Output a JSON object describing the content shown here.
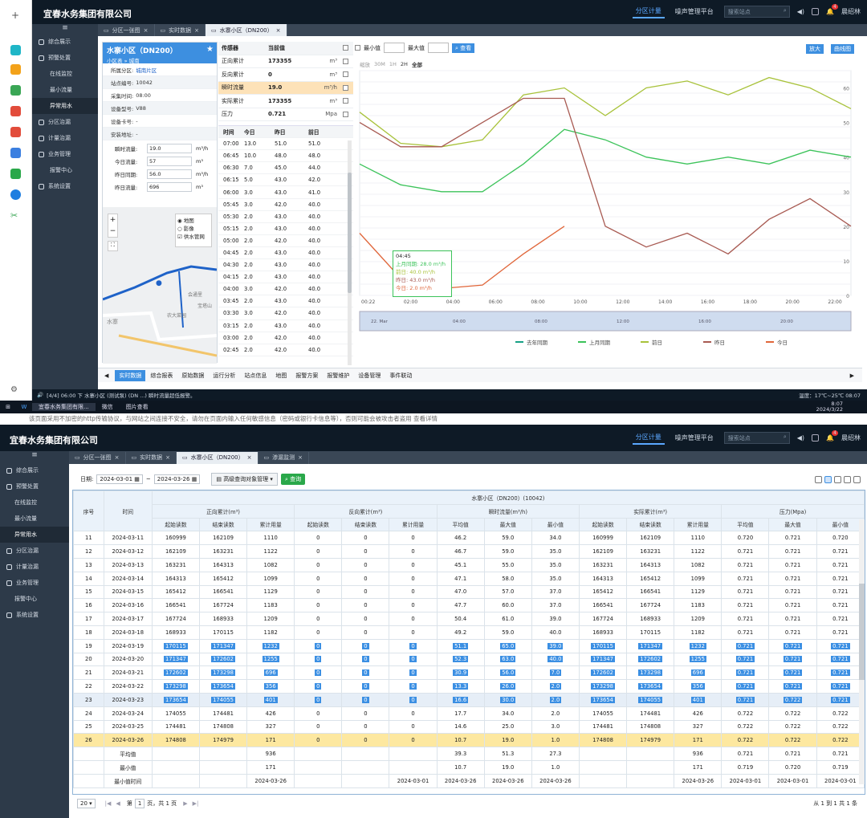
{
  "app": {
    "company": "宜春水务集团有限公司",
    "top_tabs": [
      "分区计量",
      "噪声管理平台"
    ],
    "search_placeholder": "搜索站点",
    "user": "晨绍林",
    "notif_count": "4"
  },
  "nav": {
    "items": [
      "综合展示",
      "预警处置",
      "在线监控",
      "最小流量",
      "异常用水",
      "分区治漏",
      "计量治漏",
      "业务管理",
      "报警中心",
      "系统设置"
    ]
  },
  "top": {
    "tabs": [
      "分区一张图",
      "实时数据",
      "水寨小区（DN200）"
    ],
    "station": {
      "name": "水寨小区（DN200）",
      "breadcrumb": "小区表 » 城南",
      "fields": [
        {
          "label": "所属分区:",
          "value": "城南片区"
        },
        {
          "label": "站点编号:",
          "value": "10042"
        },
        {
          "label": "采集时间:",
          "value": "08:00"
        },
        {
          "label": "设备型号:",
          "value": "V88"
        },
        {
          "label": "设备卡号:",
          "value": "-"
        },
        {
          "label": "安装地址:",
          "value": "-"
        }
      ],
      "inputs": [
        {
          "label": "瞬时流量:",
          "value": "19.0",
          "unit": "m³/h"
        },
        {
          "label": "今日流量:",
          "value": "57",
          "unit": "m³"
        },
        {
          "label": "昨日同期:",
          "value": "56.0",
          "unit": "m³/h"
        },
        {
          "label": "昨日流量:",
          "value": "696",
          "unit": "m³"
        }
      ],
      "map_opts": [
        "地图",
        "影像",
        "供水管网"
      ],
      "map_labels": [
        "会通里",
        "宝塔山",
        "农大菜园",
        "水寨"
      ]
    },
    "sensor": {
      "head": [
        "传感器",
        "当前值"
      ],
      "rows": [
        {
          "name": "正向累计",
          "value": "173355",
          "unit": "m³"
        },
        {
          "name": "反向累计",
          "value": "0",
          "unit": "m³"
        },
        {
          "name": "瞬时流量",
          "value": "19.0",
          "unit": "m³/h"
        },
        {
          "name": "实际累计",
          "value": "173355",
          "unit": "m³"
        },
        {
          "name": "压力",
          "value": "0.721",
          "unit": "Mpa"
        }
      ]
    },
    "hourly": {
      "head": [
        "时间",
        "今日",
        "昨日",
        "前日"
      ],
      "rows": [
        [
          "07:00",
          "13.0",
          "51.0",
          "51.0"
        ],
        [
          "06:45",
          "10.0",
          "48.0",
          "48.0"
        ],
        [
          "06:30",
          "7.0",
          "45.0",
          "44.0"
        ],
        [
          "06:15",
          "5.0",
          "43.0",
          "42.0"
        ],
        [
          "06:00",
          "3.0",
          "43.0",
          "41.0"
        ],
        [
          "05:45",
          "3.0",
          "42.0",
          "40.0"
        ],
        [
          "05:30",
          "2.0",
          "43.0",
          "40.0"
        ],
        [
          "05:15",
          "2.0",
          "43.0",
          "40.0"
        ],
        [
          "05:00",
          "2.0",
          "42.0",
          "40.0"
        ],
        [
          "04:45",
          "2.0",
          "43.0",
          "40.0"
        ],
        [
          "04:30",
          "2.0",
          "43.0",
          "40.0"
        ],
        [
          "04:15",
          "2.0",
          "43.0",
          "40.0"
        ],
        [
          "04:00",
          "3.0",
          "42.0",
          "40.0"
        ],
        [
          "03:45",
          "2.0",
          "43.0",
          "40.0"
        ],
        [
          "03:30",
          "3.0",
          "42.0",
          "40.0"
        ],
        [
          "03:15",
          "2.0",
          "43.0",
          "40.0"
        ],
        [
          "03:00",
          "2.0",
          "42.0",
          "40.0"
        ],
        [
          "02:45",
          "2.0",
          "42.0",
          "40.0"
        ]
      ]
    },
    "chart_toolbar": {
      "min_label": "最小值",
      "max_label": "最大值",
      "query": "查看",
      "btn_zoom": "放大",
      "btn_curve": "曲线图",
      "ranges": [
        "缩放",
        "30M",
        "1H",
        "2H",
        "全部"
      ]
    },
    "bottom_tabs": [
      "实时数据",
      "综合报表",
      "原始数据",
      "运行分析",
      "站点信息",
      "地图",
      "报警方案",
      "报警维护",
      "设备管理",
      "事件联动"
    ],
    "status": "[4/4] 06:00 下 水寨小区 (测试泵) (DN ...) 瞬时流量超低报警。",
    "weather": "温度：17℃~25℃  08:07",
    "taskbar_apps": [
      "宜春水务集团有限...",
      "微信",
      "图片查看"
    ],
    "clock_time": "8:07",
    "clock_date": "2024/3/22"
  },
  "notice": "该页面采用不加密的http传输协议，与网站之间连接不安全，请勿在页面内输入任何敏感信息（密码或银行卡信息等），否则可能会被攻击者盗用  查看详情",
  "bottom": {
    "tabs": [
      "分区一张图",
      "实时数据",
      "水寨小区（DN200）",
      "渗漏监测"
    ],
    "date_label": "日期:",
    "date_from": "2024-03-01",
    "date_to": "2024-03-26",
    "adv_btn": "高级查询对象管理",
    "query_btn": "查询",
    "table_title": "水寨小区（DN200）(10042)",
    "groups": [
      "正向累计(m³)",
      "反向累计(m³)",
      "瞬时流量(m³/h)",
      "实际累计(m³)",
      "压力(Mpa)"
    ],
    "col_seq": "序号",
    "col_time": "时间",
    "sub": [
      "起始读数",
      "结束读数",
      "累计用量",
      "起始读数",
      "结束读数",
      "累计用量",
      "平均值",
      "最大值",
      "最小值",
      "起始读数",
      "结束读数",
      "累计用量",
      "平均值",
      "最大值",
      "最小值"
    ],
    "rows": [
      [
        "11",
        "2024-03-11",
        "160999",
        "162109",
        "1110",
        "0",
        "0",
        "0",
        "46.2",
        "59.0",
        "34.0",
        "160999",
        "162109",
        "1110",
        "0.720",
        "0.721",
        "0.720"
      ],
      [
        "12",
        "2024-03-12",
        "162109",
        "163231",
        "1122",
        "0",
        "0",
        "0",
        "46.7",
        "59.0",
        "35.0",
        "162109",
        "163231",
        "1122",
        "0.721",
        "0.721",
        "0.721"
      ],
      [
        "13",
        "2024-03-13",
        "163231",
        "164313",
        "1082",
        "0",
        "0",
        "0",
        "45.1",
        "55.0",
        "35.0",
        "163231",
        "164313",
        "1082",
        "0.721",
        "0.721",
        "0.721"
      ],
      [
        "14",
        "2024-03-14",
        "164313",
        "165412",
        "1099",
        "0",
        "0",
        "0",
        "47.1",
        "58.0",
        "35.0",
        "164313",
        "165412",
        "1099",
        "0.721",
        "0.721",
        "0.721"
      ],
      [
        "15",
        "2024-03-15",
        "165412",
        "166541",
        "1129",
        "0",
        "0",
        "0",
        "47.0",
        "57.0",
        "37.0",
        "165412",
        "166541",
        "1129",
        "0.721",
        "0.721",
        "0.721"
      ],
      [
        "16",
        "2024-03-16",
        "166541",
        "167724",
        "1183",
        "0",
        "0",
        "0",
        "47.7",
        "60.0",
        "37.0",
        "166541",
        "167724",
        "1183",
        "0.721",
        "0.721",
        "0.721"
      ],
      [
        "17",
        "2024-03-17",
        "167724",
        "168933",
        "1209",
        "0",
        "0",
        "0",
        "50.4",
        "61.0",
        "39.0",
        "167724",
        "168933",
        "1209",
        "0.721",
        "0.721",
        "0.721"
      ],
      [
        "18",
        "2024-03-18",
        "168933",
        "170115",
        "1182",
        "0",
        "0",
        "0",
        "49.2",
        "59.0",
        "40.0",
        "168933",
        "170115",
        "1182",
        "0.721",
        "0.721",
        "0.721"
      ],
      [
        "19",
        "2024-03-19",
        "170115",
        "171347",
        "1232",
        "0",
        "0",
        "0",
        "51.1",
        "65.0",
        "39.0",
        "170115",
        "171347",
        "1232",
        "0.721",
        "0.721",
        "0.721"
      ],
      [
        "20",
        "2024-03-20",
        "171347",
        "172602",
        "1255",
        "0",
        "0",
        "0",
        "52.3",
        "63.0",
        "40.0",
        "171347",
        "172602",
        "1255",
        "0.721",
        "0.721",
        "0.721"
      ],
      [
        "21",
        "2024-03-21",
        "172602",
        "173298",
        "696",
        "0",
        "0",
        "0",
        "30.9",
        "56.0",
        "7.0",
        "172602",
        "173298",
        "696",
        "0.721",
        "0.721",
        "0.721"
      ],
      [
        "22",
        "2024-03-22",
        "173298",
        "173654",
        "356",
        "0",
        "0",
        "0",
        "13.3",
        "26.0",
        "2.0",
        "173298",
        "173654",
        "356",
        "0.721",
        "0.721",
        "0.721"
      ],
      [
        "23",
        "2024-03-23",
        "173654",
        "174055",
        "401",
        "0",
        "0",
        "0",
        "16.6",
        "30.0",
        "2.0",
        "173654",
        "174055",
        "401",
        "0.721",
        "0.722",
        "0.721"
      ],
      [
        "24",
        "2024-03-24",
        "174055",
        "174481",
        "426",
        "0",
        "0",
        "0",
        "17.7",
        "34.0",
        "2.0",
        "174055",
        "174481",
        "426",
        "0.722",
        "0.722",
        "0.722"
      ],
      [
        "25",
        "2024-03-25",
        "174481",
        "174808",
        "327",
        "0",
        "0",
        "0",
        "14.6",
        "25.0",
        "3.0",
        "174481",
        "174808",
        "327",
        "0.722",
        "0.722",
        "0.722"
      ],
      [
        "26",
        "2024-03-26",
        "174808",
        "174979",
        "171",
        "0",
        "0",
        "0",
        "10.7",
        "19.0",
        "1.0",
        "174808",
        "174979",
        "171",
        "0.722",
        "0.722",
        "0.722"
      ]
    ],
    "summary": [
      [
        "",
        "平均值",
        "",
        "",
        "936",
        "",
        "",
        "",
        "39.3",
        "51.3",
        "27.3",
        "",
        "",
        "936",
        "0.721",
        "0.721",
        "0.721"
      ],
      [
        "",
        "最小值",
        "",
        "",
        "171",
        "",
        "",
        "",
        "10.7",
        "19.0",
        "1.0",
        "",
        "",
        "171",
        "0.719",
        "0.720",
        "0.719"
      ],
      [
        "",
        "最小值时间",
        "",
        "",
        "2024-03-26",
        "",
        "",
        "2024-03-01",
        "2024-03-26",
        "2024-03-26",
        "2024-03-26",
        "",
        "",
        "2024-03-26",
        "2024-03-01",
        "2024-03-01",
        "2024-03-01"
      ]
    ],
    "pager": {
      "size": "20",
      "page_pre": "第",
      "page": "1",
      "page_post": "页，共 1 页",
      "summary": "从 1 到 1 共 1 条"
    }
  },
  "chart_data": {
    "type": "line",
    "x": [
      "00:22",
      "02:00",
      "04:00",
      "06:00",
      "08:00",
      "10:00",
      "12:00",
      "14:00",
      "16:00",
      "18:00",
      "20:00",
      "22:00"
    ],
    "ylim": [
      0,
      65
    ],
    "y_ticks": [
      0,
      10,
      20,
      30,
      40,
      50,
      60
    ],
    "legend": [
      "去年同期",
      "上月同期",
      "前日",
      "昨日",
      "今日"
    ],
    "series": [
      {
        "name": "去年同期",
        "color": "#16a085",
        "values": []
      },
      {
        "name": "上月同期",
        "color": "#3cc35a",
        "values": [
          38,
          32,
          30,
          30,
          38,
          48,
          45,
          40,
          38,
          40,
          38,
          42,
          40
        ]
      },
      {
        "name": "前日",
        "color": "#a8c23a",
        "values": [
          53,
          44,
          43,
          45,
          58,
          60,
          52,
          60,
          62,
          58,
          63,
          60,
          54
        ]
      },
      {
        "name": "昨日",
        "color": "#a85a52",
        "values": [
          50,
          43,
          43,
          50,
          57,
          57,
          20,
          14,
          18,
          12,
          22,
          28,
          20
        ]
      },
      {
        "name": "今日",
        "color": "#e0663a",
        "values": [
          18,
          5,
          2,
          3,
          12,
          20,
          null,
          null,
          null,
          null,
          null,
          null,
          null
        ]
      }
    ],
    "tooltip": {
      "time": "04:45",
      "lines": [
        "上月同期: 28.0 m³/h",
        "前日: 40.0 m³/h",
        "昨日: 43.0 m³/h",
        "今日: 2.0 m³/h"
      ]
    },
    "navigator_labels": [
      "22. Mar",
      "04:00",
      "08:00",
      "12:00",
      "16:00",
      "20:00"
    ]
  }
}
